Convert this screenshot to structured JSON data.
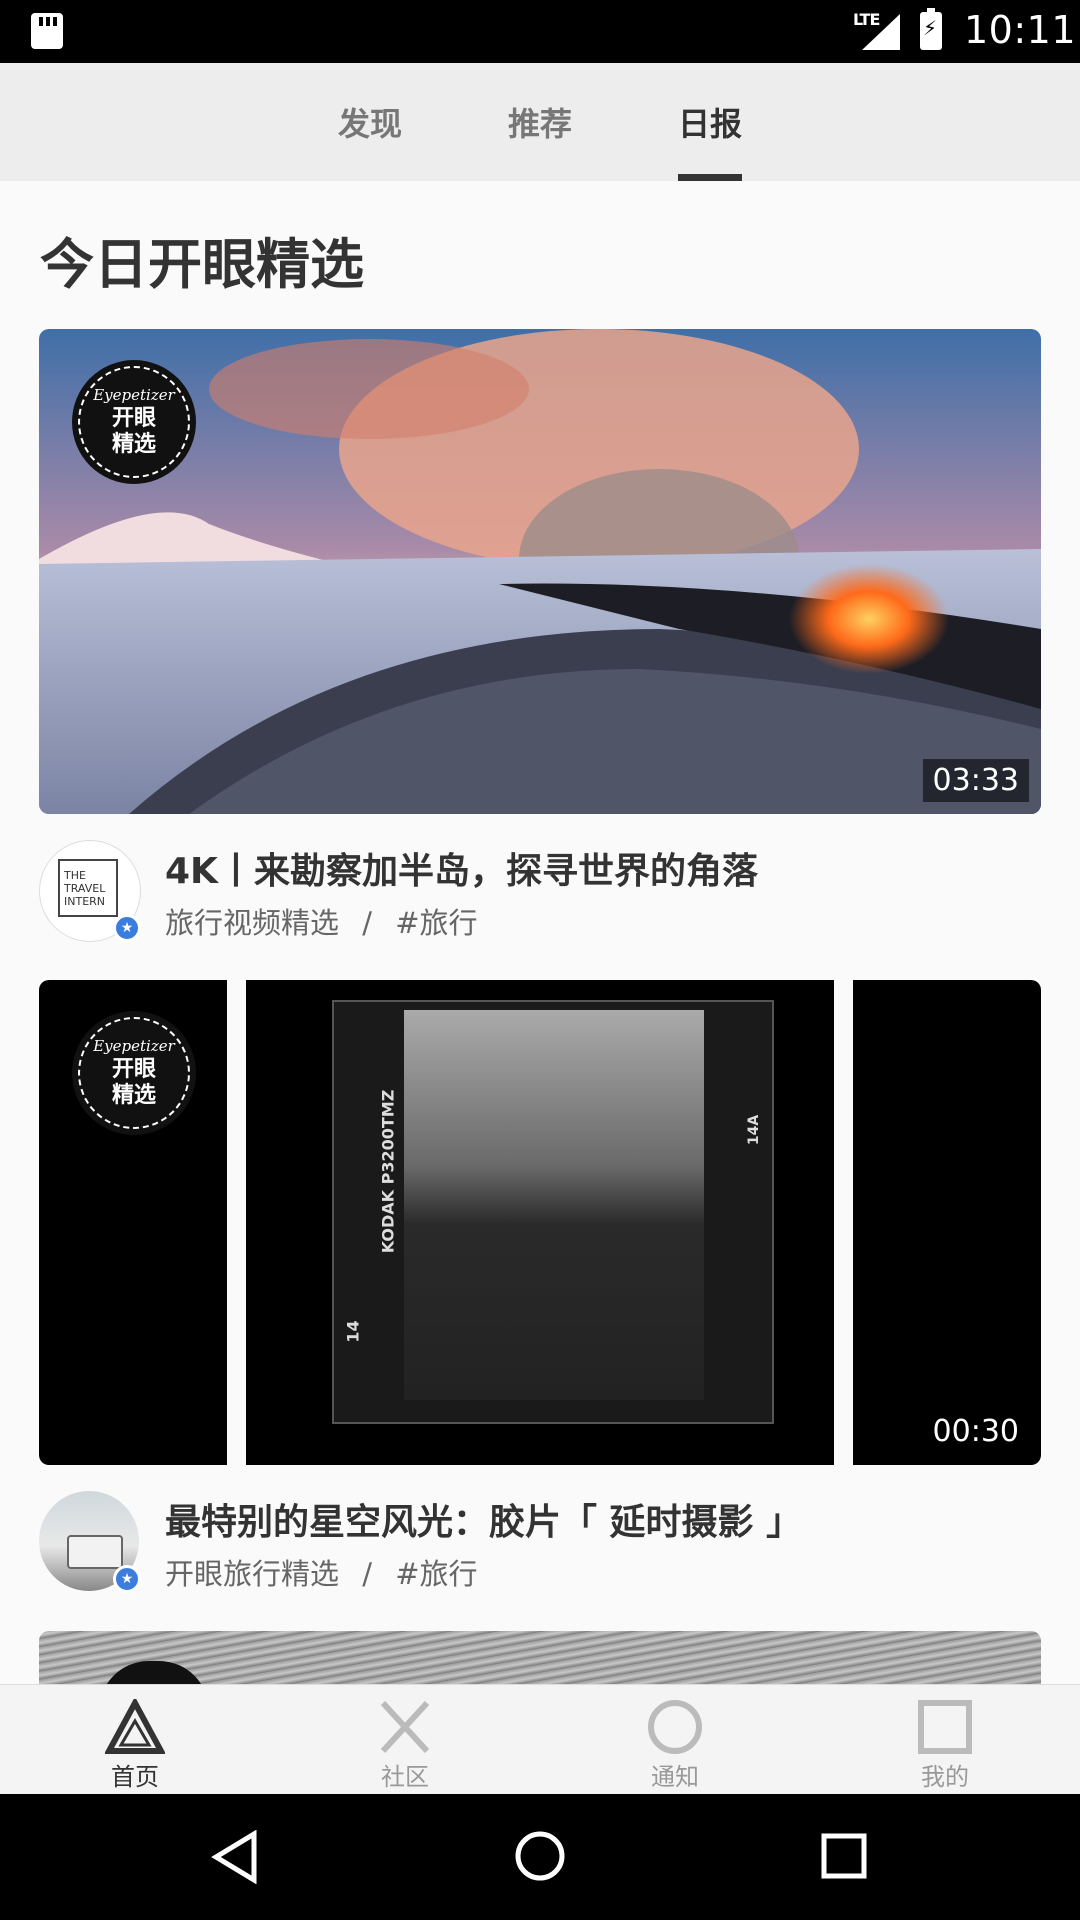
{
  "status": {
    "time": "10:11",
    "network": "LTE"
  },
  "tabs": [
    {
      "label": "发现",
      "active": false
    },
    {
      "label": "推荐",
      "active": false
    },
    {
      "label": "日报",
      "active": true
    }
  ],
  "section_title": "今日开眼精选",
  "badge": {
    "brand": "Eyepetizer",
    "line1": "开眼",
    "line2": "精选"
  },
  "videos": [
    {
      "duration": "03:33",
      "title": "4K丨来勘察加半岛，探寻世界的角落",
      "author": "旅行视频精选",
      "tag": "#旅行",
      "separator": "/",
      "avatar_text": "THE TRAVEL INTERN"
    },
    {
      "duration": "00:30",
      "title": "最特别的星空风光：胶片「 延时摄影 」",
      "author": "开眼旅行精选",
      "tag": "#旅行",
      "separator": "/"
    }
  ],
  "film": {
    "brand": "KODAK P3200TMZ",
    "frame": "14",
    "frame_right": "14A"
  },
  "bottom_nav": [
    {
      "label": "首页",
      "icon": "triangle-icon",
      "active": true
    },
    {
      "label": "社区",
      "icon": "cross-icon",
      "active": false
    },
    {
      "label": "通知",
      "icon": "circle-icon",
      "active": false
    },
    {
      "label": "我的",
      "icon": "square-icon",
      "active": false
    }
  ],
  "colors": {
    "active_text": "#333333",
    "inactive_text": "#999999",
    "verified": "#3b7ddd"
  }
}
